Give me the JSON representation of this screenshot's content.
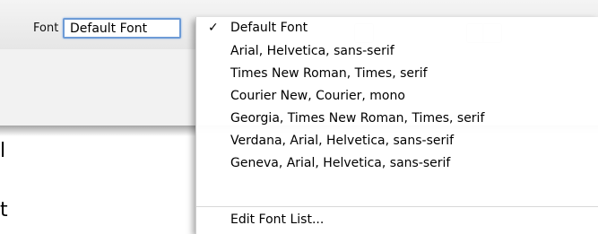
{
  "toolbar": {
    "font_label": "Font",
    "font_value": "Default Font"
  },
  "page_fragments": [
    "l",
    "t"
  ],
  "font_menu": {
    "selected": "Default Font",
    "check_glyph": "✓",
    "items": [
      {
        "label": "Default Font",
        "checked": true
      },
      {
        "label": "Arial, Helvetica, sans-serif",
        "checked": false
      },
      {
        "label": "Times New Roman, Times, serif",
        "checked": false
      },
      {
        "label": "Courier New, Courier, mono",
        "checked": false
      },
      {
        "label": "Georgia, Times New Roman, Times, serif",
        "checked": false
      },
      {
        "label": "Verdana, Arial, Helvetica, sans-serif",
        "checked": false
      },
      {
        "label": "Geneva, Arial, Helvetica, sans-serif",
        "checked": false
      }
    ],
    "edit_label": "Edit Font List..."
  }
}
